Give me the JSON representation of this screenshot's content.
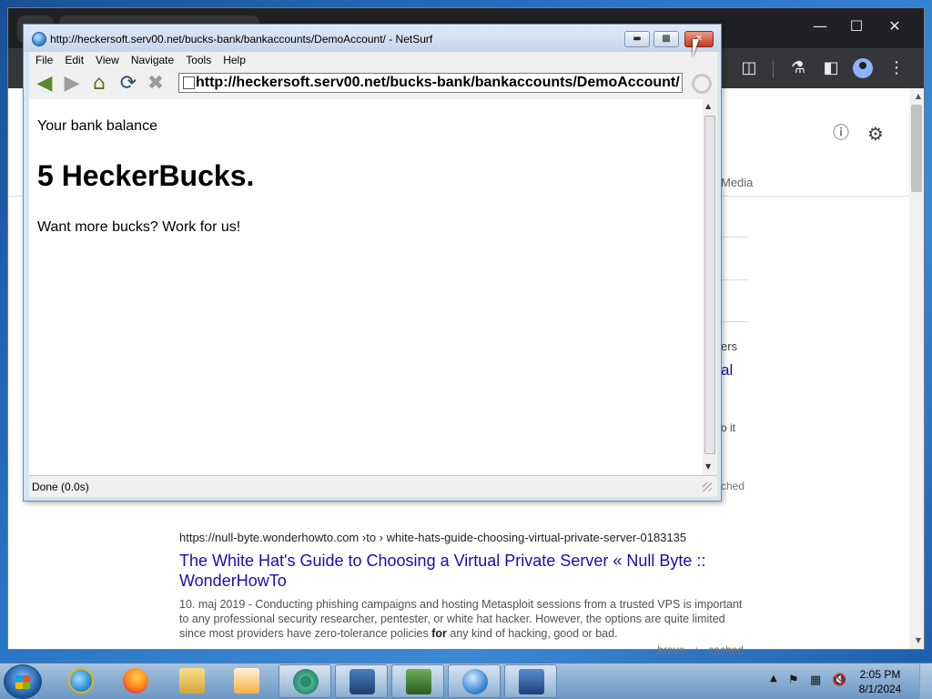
{
  "netsurf": {
    "title": "http://heckersoft.serv00.net/bucks-bank/bankaccounts/DemoAccount/  -  NetSurf",
    "menu": [
      "File",
      "Edit",
      "View",
      "Navigate",
      "Tools",
      "Help"
    ],
    "url": "http://heckersoft.serv00.net/bucks-bank/bankaccounts/DemoAccount/",
    "status": "Done (0.0s)",
    "page": {
      "line1": "Your bank balance",
      "heading": "5 HeckerBucks.",
      "line2": "Want more bucks? Work for us!"
    }
  },
  "chrome": {
    "tab_media": "Media",
    "fragments": {
      "ers": "ers",
      "al": "al",
      "o_it": "o it",
      "ched": "ched"
    },
    "result": {
      "url": "https://null-byte.wonderhowto.com  ›to › white-hats-guide-choosing-virtual-private-server-0183135",
      "title": "The White Hat's Guide to Choosing a Virtual Private Server « Null Byte :: WonderHowTo",
      "snippet_a": "10. maj 2019 - Conducting phishing campaigns and hosting Metasploit sessions from a trusted VPS is important to any professional security researcher, pentester, or white hat hacker. However, the options are quite limited since most providers have zero-tolerance policies ",
      "snippet_bold": "for",
      "snippet_b": " any kind of hacking, good or bad.",
      "meta_brave": "brave",
      "meta_sep": ":",
      "meta_cached": "cached"
    }
  },
  "taskbar": {
    "clock_time": "2:05 PM",
    "clock_date": "8/1/2024",
    "apps": [
      "Internet Explorer",
      "Firefox",
      "Windows Explorer",
      "Media Player",
      "Chrome",
      "VirtualBox",
      "Task Manager",
      "NetSurf",
      "XP Mode"
    ]
  }
}
